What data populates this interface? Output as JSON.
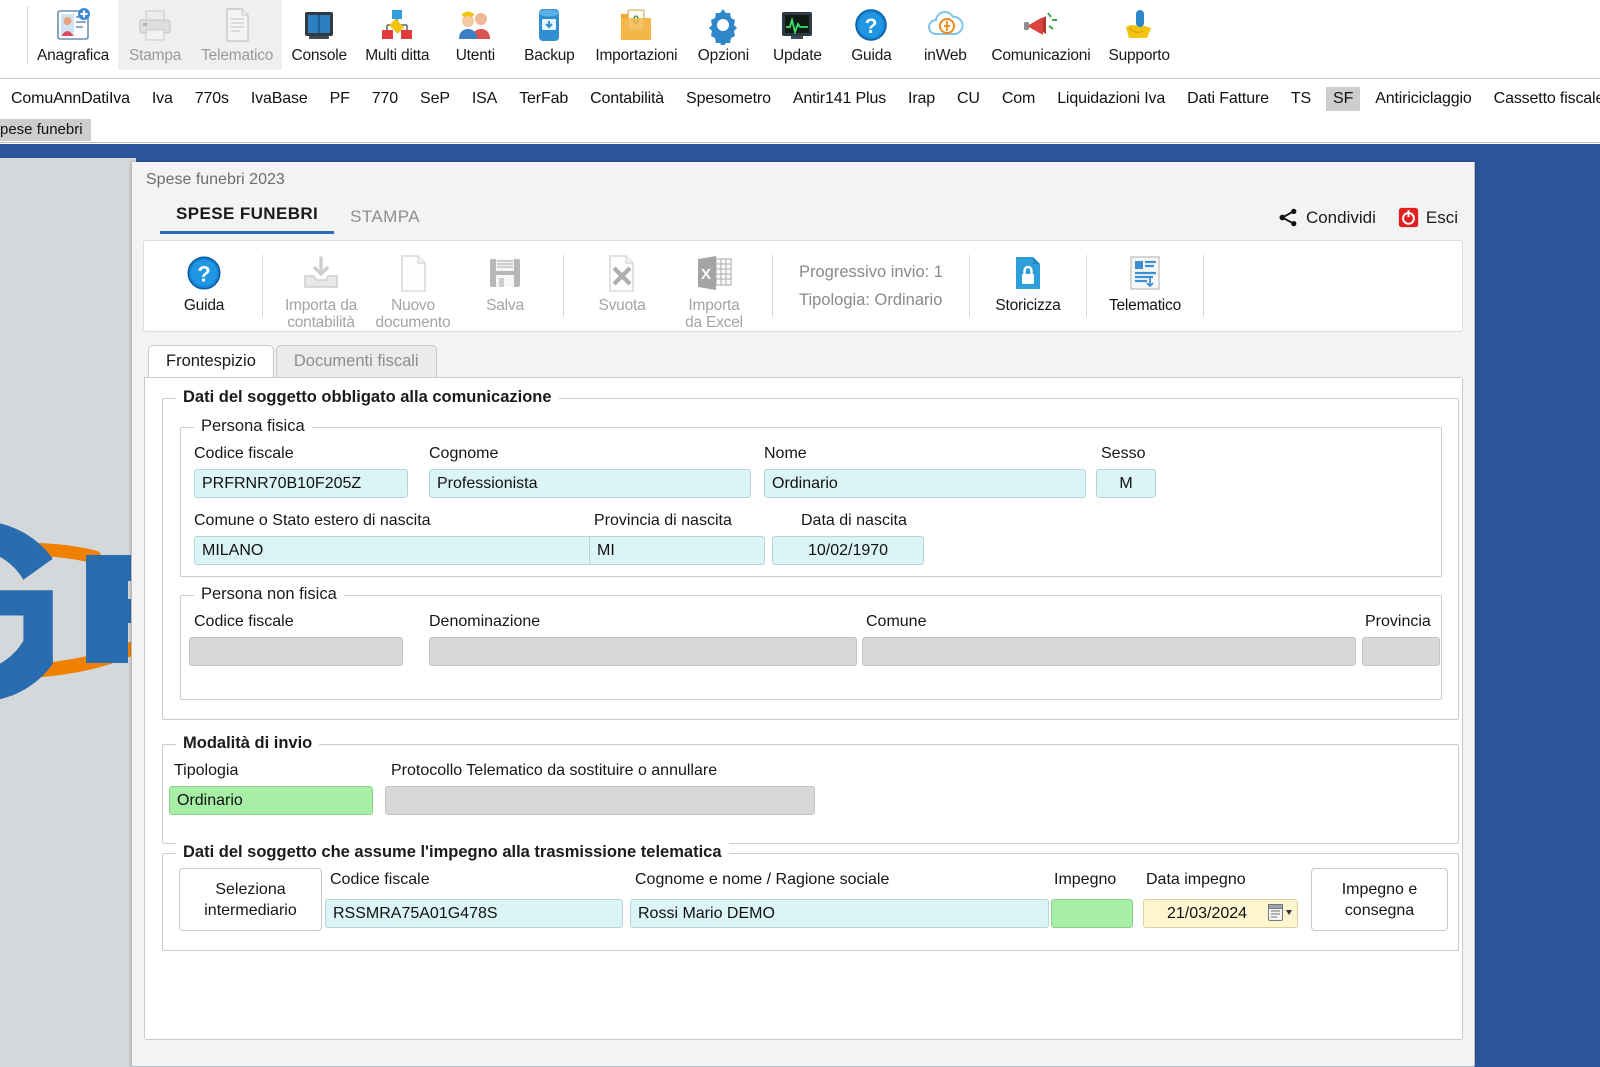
{
  "app_toolbar": [
    {
      "label": "Anagrafica",
      "icon": "id-card-icon",
      "disabled": false
    },
    {
      "label": "Stampa",
      "icon": "printer-icon",
      "disabled": true
    },
    {
      "label": "Telematico",
      "icon": "document-lines-icon",
      "disabled": true
    },
    {
      "label": "Console",
      "icon": "console-icon",
      "disabled": false
    },
    {
      "label": "Multi ditta",
      "icon": "org-chart-icon",
      "disabled": false
    },
    {
      "label": "Utenti",
      "icon": "users-icon",
      "disabled": false
    },
    {
      "label": "Backup",
      "icon": "backup-icon",
      "disabled": false
    },
    {
      "label": "Importazioni",
      "icon": "import-folder-icon",
      "disabled": false
    },
    {
      "label": "Opzioni",
      "icon": "gear-icon",
      "disabled": false
    },
    {
      "label": "Update",
      "icon": "monitor-pulse-icon",
      "disabled": false
    },
    {
      "label": "Guida",
      "icon": "help-circle-icon",
      "disabled": false
    },
    {
      "label": "inWeb",
      "icon": "cloud-icon",
      "disabled": false
    },
    {
      "label": "Comunicazioni",
      "icon": "megaphone-icon",
      "disabled": false
    },
    {
      "label": "Supporto",
      "icon": "support-hand-icon",
      "disabled": false
    }
  ],
  "module_strip": [
    {
      "label": "ComuAnnDatiIva",
      "active": false
    },
    {
      "label": "Iva",
      "active": false
    },
    {
      "label": "770s",
      "active": false
    },
    {
      "label": "IvaBase",
      "active": false
    },
    {
      "label": "PF",
      "active": false
    },
    {
      "label": "770",
      "active": false
    },
    {
      "label": "SeP",
      "active": false
    },
    {
      "label": "ISA",
      "active": false
    },
    {
      "label": "TerFab",
      "active": false
    },
    {
      "label": "Contabilità",
      "active": false
    },
    {
      "label": "Spesometro",
      "active": false
    },
    {
      "label": "Antir141 Plus",
      "active": false
    },
    {
      "label": "Irap",
      "active": false
    },
    {
      "label": "CU",
      "active": false
    },
    {
      "label": "Com",
      "active": false
    },
    {
      "label": "Liquidazioni Iva",
      "active": false
    },
    {
      "label": "Dati Fatture",
      "active": false
    },
    {
      "label": "TS",
      "active": false
    },
    {
      "label": "SF",
      "active": true
    },
    {
      "label": "Antiriciclaggio",
      "active": false
    },
    {
      "label": "Cassetto fiscale",
      "active": false
    }
  ],
  "submenu": {
    "label": "pese funebri"
  },
  "window": {
    "title": "Spese funebri 2023",
    "tabs": [
      {
        "label": "SPESE FUNEBRI",
        "active": true
      },
      {
        "label": "STAMPA",
        "active": false
      }
    ],
    "actions": [
      {
        "label": "Condividi",
        "icon": "share-icon"
      },
      {
        "label": "Esci",
        "icon": "power-icon"
      }
    ]
  },
  "ribbon": {
    "items": [
      {
        "label": "Guida",
        "icon": "help-circle-icon",
        "disabled": false,
        "multiline": false
      },
      {
        "label": "Importa da\ncontabilità",
        "icon": "import-inbox-icon",
        "disabled": true
      },
      {
        "label": "Nuovo\ndocumento",
        "icon": "blank-page-icon",
        "disabled": true
      },
      {
        "label": "Salva",
        "icon": "floppy-save-icon",
        "disabled": true
      },
      {
        "label": "Svuota",
        "icon": "clear-page-icon",
        "disabled": true
      },
      {
        "label": "Importa\nda Excel",
        "icon": "excel-icon",
        "disabled": true
      },
      {
        "label": "Storicizza",
        "icon": "lock-document-icon",
        "disabled": false
      },
      {
        "label": "Telematico",
        "icon": "telematic-doc-icon",
        "disabled": false
      }
    ],
    "info_line_1": "Progressivo invio: 1",
    "info_line_2": "Tipologia: Ordinario"
  },
  "content_tabs": [
    {
      "label": "Frontespizio",
      "active": true
    },
    {
      "label": "Documenti fiscali",
      "active": false
    }
  ],
  "form": {
    "group_main": "Dati del soggetto obbligato alla comunicazione",
    "persona_fisica": {
      "legend": "Persona fisica",
      "codice_fiscale_label": "Codice fiscale",
      "codice_fiscale_value": "PRFRNR70B10F205Z",
      "cognome_label": "Cognome",
      "cognome_value": "Professionista",
      "nome_label": "Nome",
      "nome_value": "Ordinario",
      "sesso_label": "Sesso",
      "sesso_value": "M",
      "comune_label": "Comune o Stato estero di nascita",
      "comune_value": "MILANO",
      "provincia_label": "Provincia di nascita",
      "provincia_value": "MI",
      "data_label": "Data di nascita",
      "data_value": "10/02/1970"
    },
    "persona_non_fisica": {
      "legend": "Persona non fisica",
      "codice_fiscale_label": "Codice fiscale",
      "codice_fiscale_value": "",
      "denominazione_label": "Denominazione",
      "denominazione_value": "",
      "comune_label": "Comune",
      "comune_value": "",
      "provincia_label": "Provincia",
      "provincia_value": ""
    },
    "modalita_invio": {
      "legend": "Modalità di invio",
      "tipologia_label": "Tipologia",
      "tipologia_value": "Ordinario",
      "protocollo_label": "Protocollo Telematico da sostituire o annullare",
      "protocollo_value": ""
    },
    "impegno": {
      "legend": "Dati del soggetto che assume l'impegno alla trasmissione telematica",
      "seleziona_btn": "Seleziona\nintermediario",
      "codice_fiscale_label": "Codice fiscale",
      "codice_fiscale_value": "RSSMRA75A01G478S",
      "cognome_label": "Cognome e nome / Ragione sociale",
      "cognome_value": "Rossi Mario DEMO",
      "impegno_label": "Impegno",
      "impegno_value": "",
      "data_label": "Data impegno",
      "data_value": "21/03/2024",
      "consegna_btn": "Impegno e\nconsegna"
    }
  },
  "colors": {
    "desktop_blue": "#2a5699",
    "accent_blue": "#2b6cb8",
    "field_cyan": "#dbf4f6",
    "field_green": "#a7efa7",
    "field_date": "#fdf4d0",
    "field_readonly": "#d8d8d8",
    "logo_blue": "#2a6cb0",
    "logo_orange": "#f08000",
    "exit_red": "#e02020"
  }
}
